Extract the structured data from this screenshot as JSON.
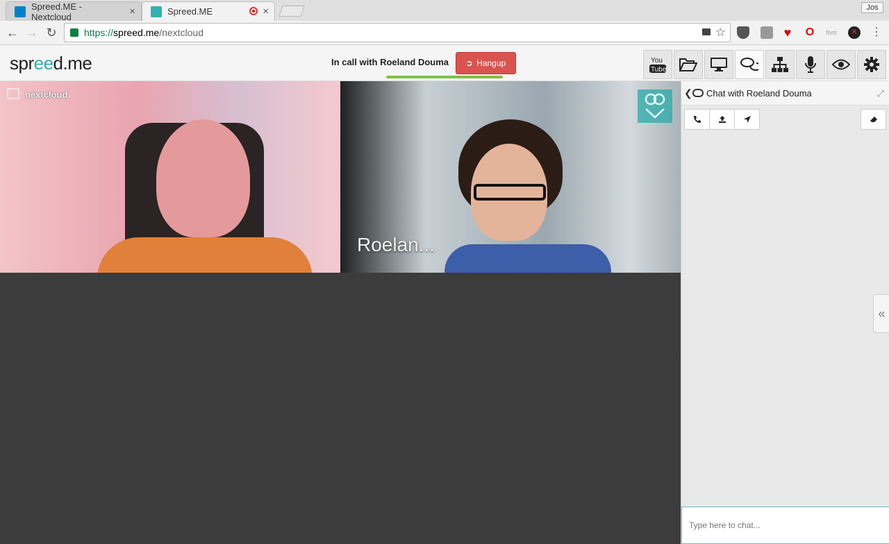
{
  "browser": {
    "tabs": [
      {
        "title": "Spreed.ME - Nextcloud",
        "active": false,
        "favicon_color": "#0082c9"
      },
      {
        "title": "Spreed.ME",
        "active": true,
        "favicon_color": "#34b1b1",
        "recording": true
      }
    ],
    "close_glyph": "×",
    "profile": "Jos",
    "url": {
      "protocol": "https://",
      "host": "spreed.me",
      "path": "/nextcloud"
    }
  },
  "app": {
    "logo": {
      "prefix": "spr",
      "middle": "ee",
      "suffix": "d.me"
    },
    "call_status": "In call with Roeland Douma",
    "hangup_label": "Hangup",
    "toolbar": [
      {
        "name": "youtube-button",
        "icon": "youtube-icon",
        "label": "You\nTube"
      },
      {
        "name": "files-button",
        "icon": "folder-open-icon"
      },
      {
        "name": "screenshare-button",
        "icon": "desktop-icon"
      },
      {
        "name": "chat-button",
        "icon": "chat-bubbles-icon",
        "active": true
      },
      {
        "name": "roomlist-button",
        "icon": "sitemap-icon"
      },
      {
        "name": "mic-button",
        "icon": "microphone-icon"
      },
      {
        "name": "camera-button",
        "icon": "eye-icon"
      },
      {
        "name": "settings-button",
        "icon": "gear-icon"
      }
    ]
  },
  "video": {
    "local_label": "nextcloud",
    "remote_label": "Roelan..."
  },
  "chat": {
    "title": "Chat with Roeland Douma",
    "input_placeholder": "Type here to chat..."
  },
  "colors": {
    "accent": "#34b1b1",
    "hangup": "#d9534f",
    "call_progress": "#7cc242"
  }
}
